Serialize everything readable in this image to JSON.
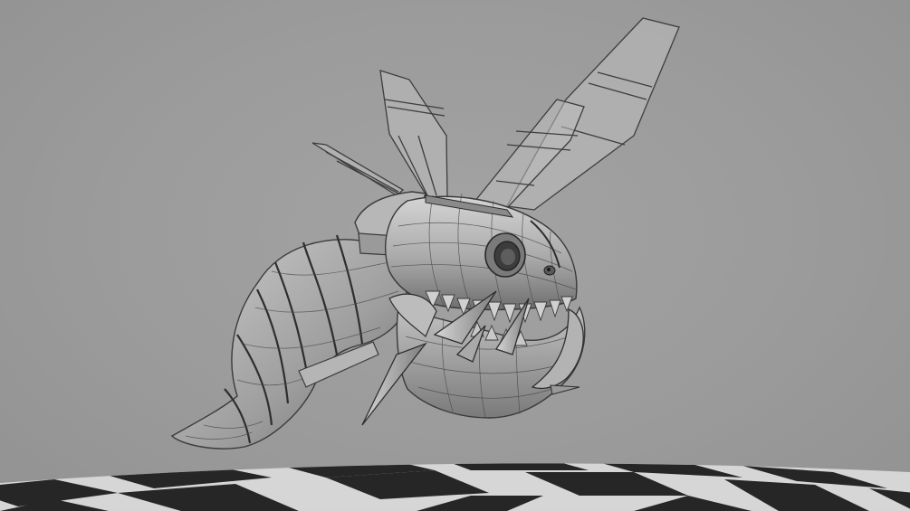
{
  "scene": {
    "subject": "",
    "colors": {
      "background": "#9a9a9a",
      "body_light": "#cfcfcf",
      "body_mid": "#a8a8a8",
      "body_dark": "#6e6e6e",
      "wire": "#3a3a3a",
      "checker_light": "#d8d8d8",
      "checker_dark": "#2a2a2a"
    }
  }
}
